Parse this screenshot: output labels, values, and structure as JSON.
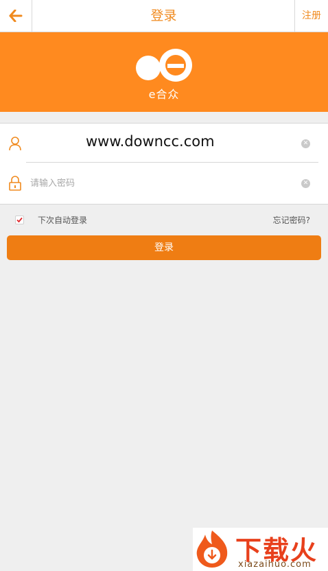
{
  "header": {
    "title": "登录",
    "register_label": "注册",
    "back_icon": "arrow-left-icon"
  },
  "banner": {
    "logo_text": "e合众",
    "brand_color": "#ff8a1f"
  },
  "form": {
    "username_value": "www.downcc.com",
    "password_placeholder": "请输入密码",
    "password_value": ""
  },
  "options": {
    "remember_label": "下次自动登录",
    "remember_checked": true,
    "forgot_label": "忘记密码?"
  },
  "login_button": {
    "label": "登录"
  },
  "watermark": {
    "text": "下载火",
    "url": "xiazaihuo.com"
  }
}
